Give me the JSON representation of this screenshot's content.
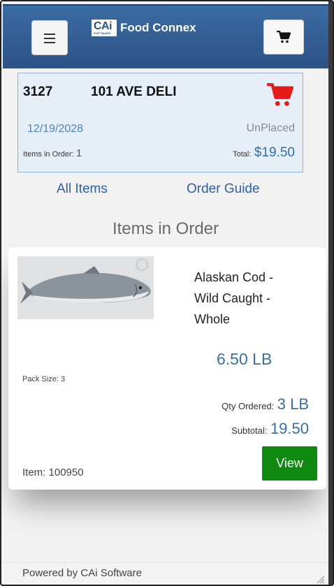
{
  "header": {
    "logo_brand": "CAi",
    "logo_sub": "SOFTWARE",
    "app_name": "Food Connex"
  },
  "order": {
    "number": "3127",
    "customer": "101 AVE DELI",
    "date": "12/19/2028",
    "status": "UnPlaced",
    "items_label": "Items in Order:",
    "items_count": "1",
    "total_label": "Total:",
    "total_value": "$19.50"
  },
  "nav": {
    "all_items": "All Items",
    "order_guide": "Order Guide"
  },
  "section_title": "Items in Order",
  "item": {
    "name_line1": "Alaskan Cod -",
    "name_line2": "Wild Caught -",
    "name_line3": "Whole",
    "weight": "6.50 LB",
    "pack_size": "Pack Size: 3",
    "qty_label": "Qty Ordered:",
    "qty_value": "3 LB",
    "subtotal_label": "Subtotal:",
    "subtotal_value": "19.50",
    "item_id": "Item:  100950",
    "view_label": "View"
  },
  "footer": {
    "text": "Powered by CAi Software"
  },
  "colors": {
    "header_blue": "#2c5287",
    "cart_red": "#e41b1b",
    "view_green": "#108a10",
    "link_blue": "#2f5fa8"
  }
}
